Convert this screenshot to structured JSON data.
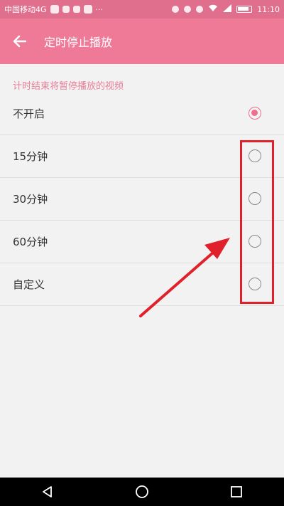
{
  "status_bar": {
    "carrier": "中国移动4G",
    "time": "11:10"
  },
  "app_bar": {
    "title": "定时停止播放"
  },
  "hint": "计时结束将暂停播放的视频",
  "options": [
    {
      "label": "不开启",
      "checked": true
    },
    {
      "label": "15分钟",
      "checked": false
    },
    {
      "label": "30分钟",
      "checked": false
    },
    {
      "label": "60分钟",
      "checked": false
    },
    {
      "label": "自定义",
      "checked": false
    }
  ],
  "colors": {
    "status_bar": "#e06e8d",
    "app_bar": "#ef7a98",
    "accent": "#ec6f8e",
    "annotation": "#e0202a"
  },
  "icons": {
    "back": "arrow-left-icon",
    "nav_back": "triangle-back-icon",
    "nav_home": "circle-home-icon",
    "nav_recents": "square-recents-icon"
  }
}
